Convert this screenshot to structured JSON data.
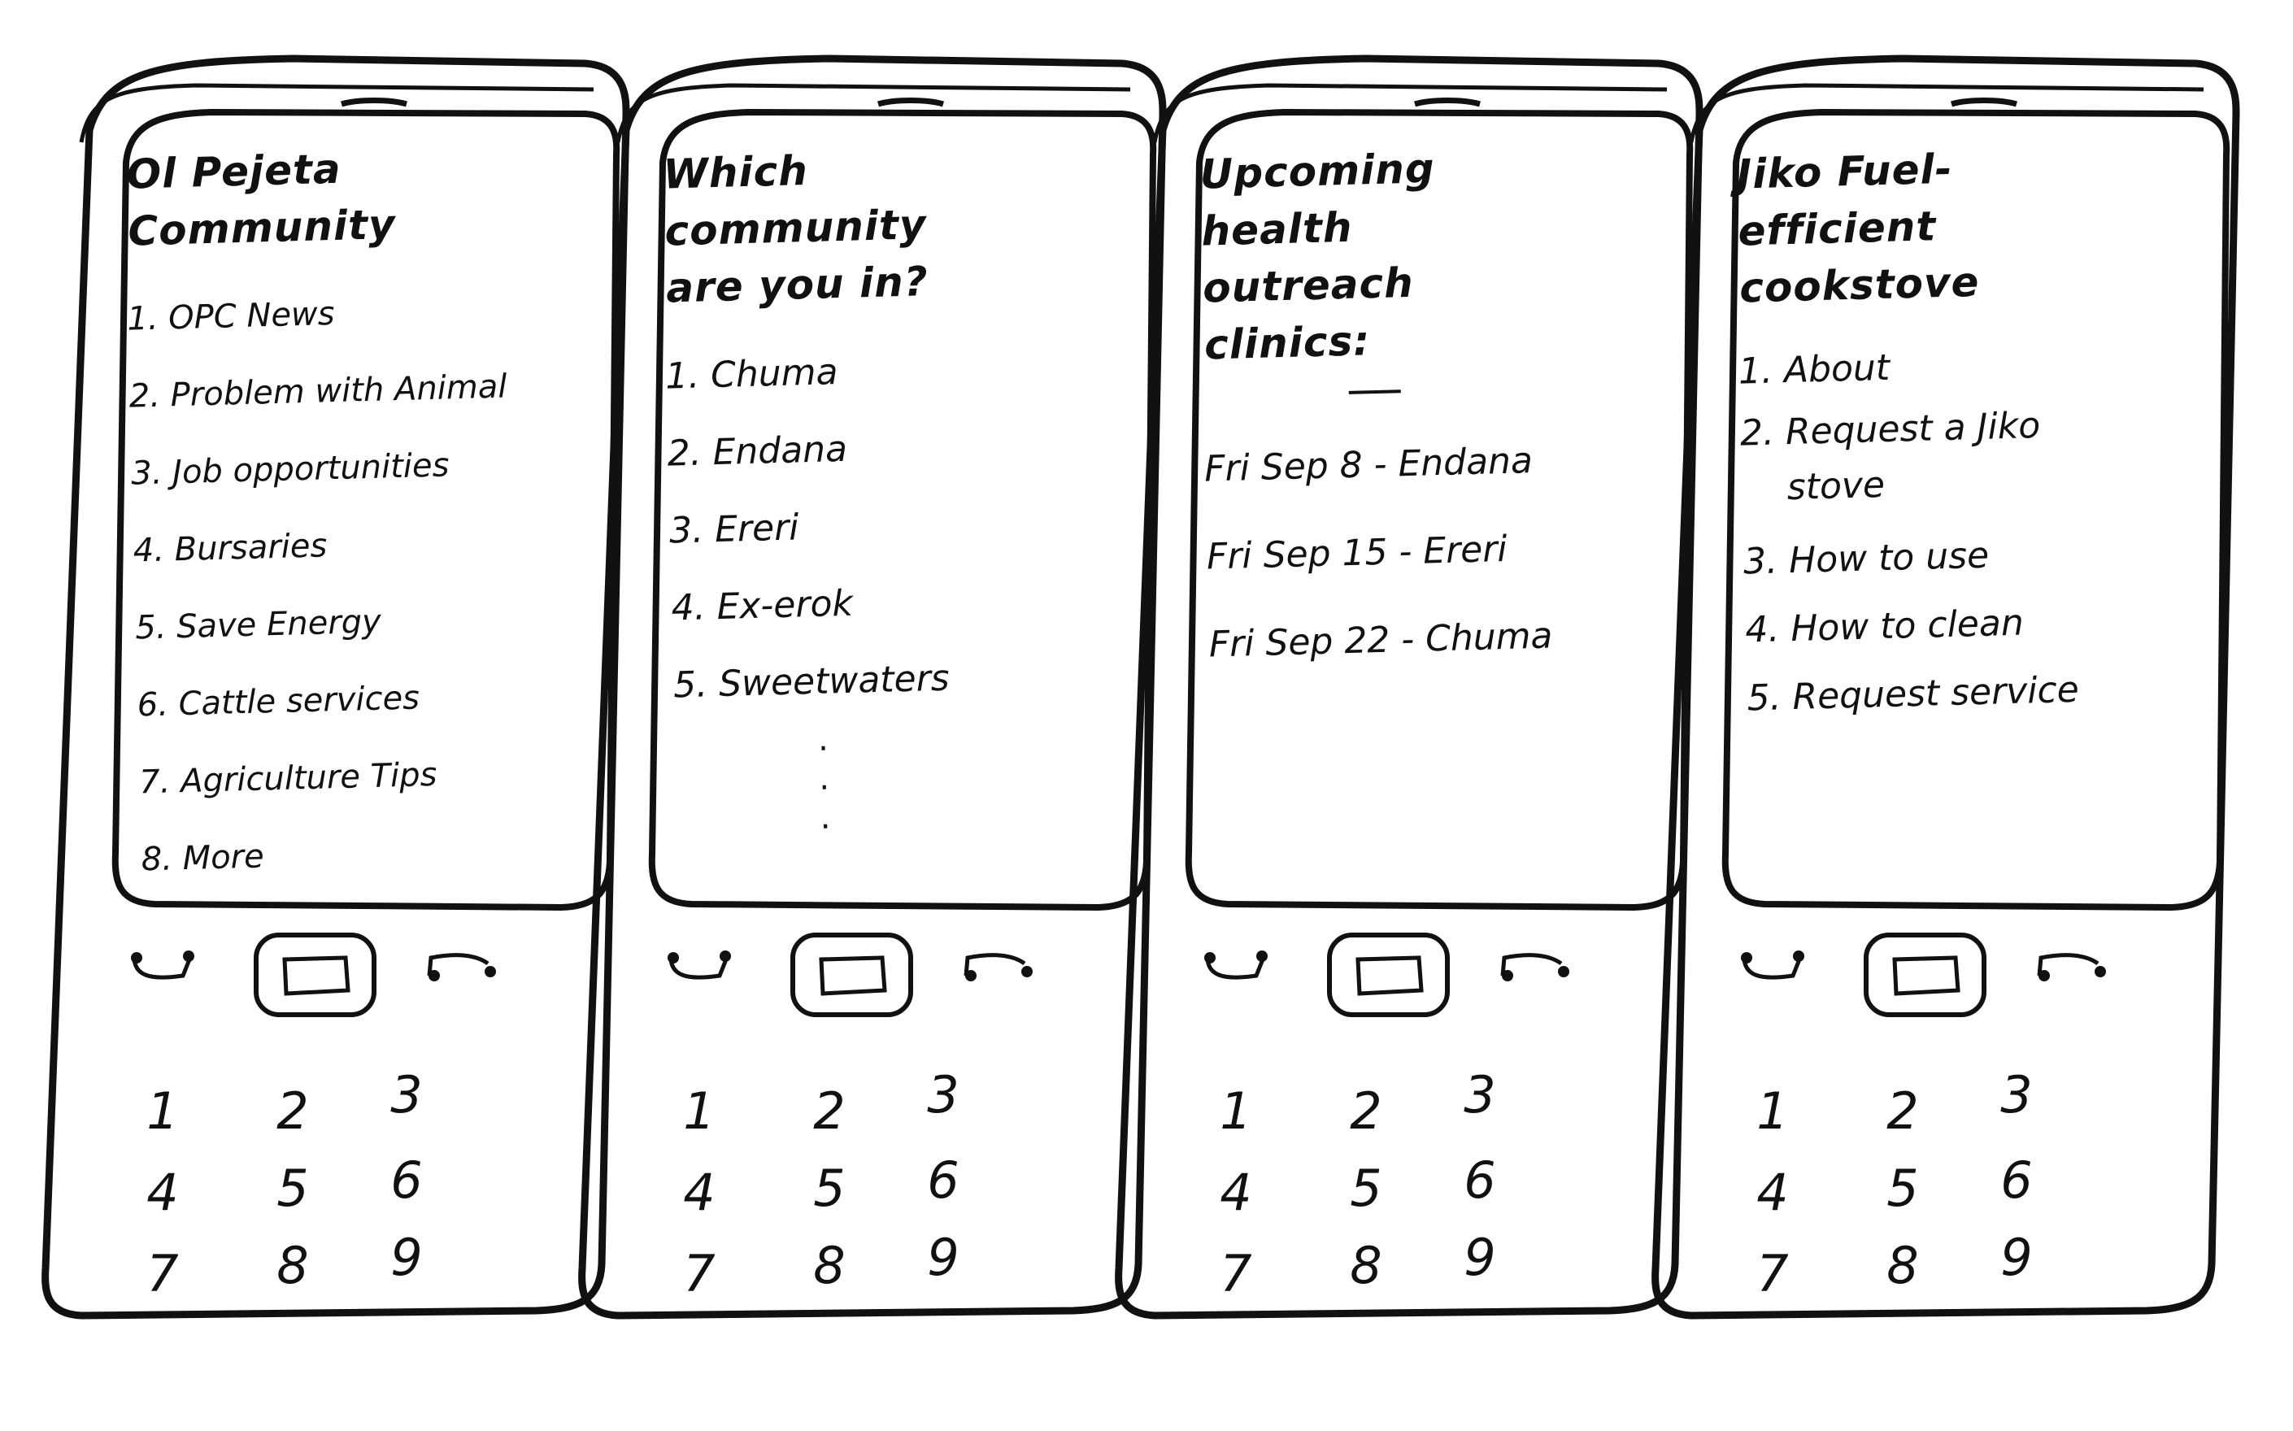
{
  "phones": [
    {
      "title": "Ol Pejeta Community",
      "items": [
        "1. OPC News",
        "2. Problem with Animal",
        "3. Job opportunities",
        "4. Bursaries",
        "5. Save Energy",
        "6. Cattle services",
        "7. Agriculture Tips",
        "8. More"
      ],
      "keys": [
        "1",
        "2",
        "3",
        "4",
        "5",
        "6",
        "7",
        "8",
        "9"
      ]
    },
    {
      "title": "Which community are you in?",
      "items": [
        "1. Chuma",
        "2. Endana",
        "3. Ereri",
        "4. Ex-erok",
        "5. Sweetwaters"
      ],
      "continuation": [
        ".",
        ".",
        "."
      ],
      "keys": [
        "1",
        "2",
        "3",
        "4",
        "5",
        "6",
        "7",
        "8",
        "9"
      ]
    },
    {
      "title": "Upcoming health outreach clinics:",
      "items": [
        "Fri Sep 8 - Endana",
        "Fri Sep 15 - Ereri",
        "Fri Sep 22 - Chuma"
      ],
      "keys": [
        "1",
        "2",
        "3",
        "4",
        "5",
        "6",
        "7",
        "8",
        "9"
      ]
    },
    {
      "title": "Jiko Fuel-efficient cookstove",
      "items": [
        "1. About",
        "2. Request a Jiko stove",
        "3. How to use",
        "4. How to clean",
        "5. Request service"
      ],
      "keys": [
        "1",
        "2",
        "3",
        "4",
        "5",
        "6",
        "7",
        "8",
        "9"
      ]
    }
  ]
}
